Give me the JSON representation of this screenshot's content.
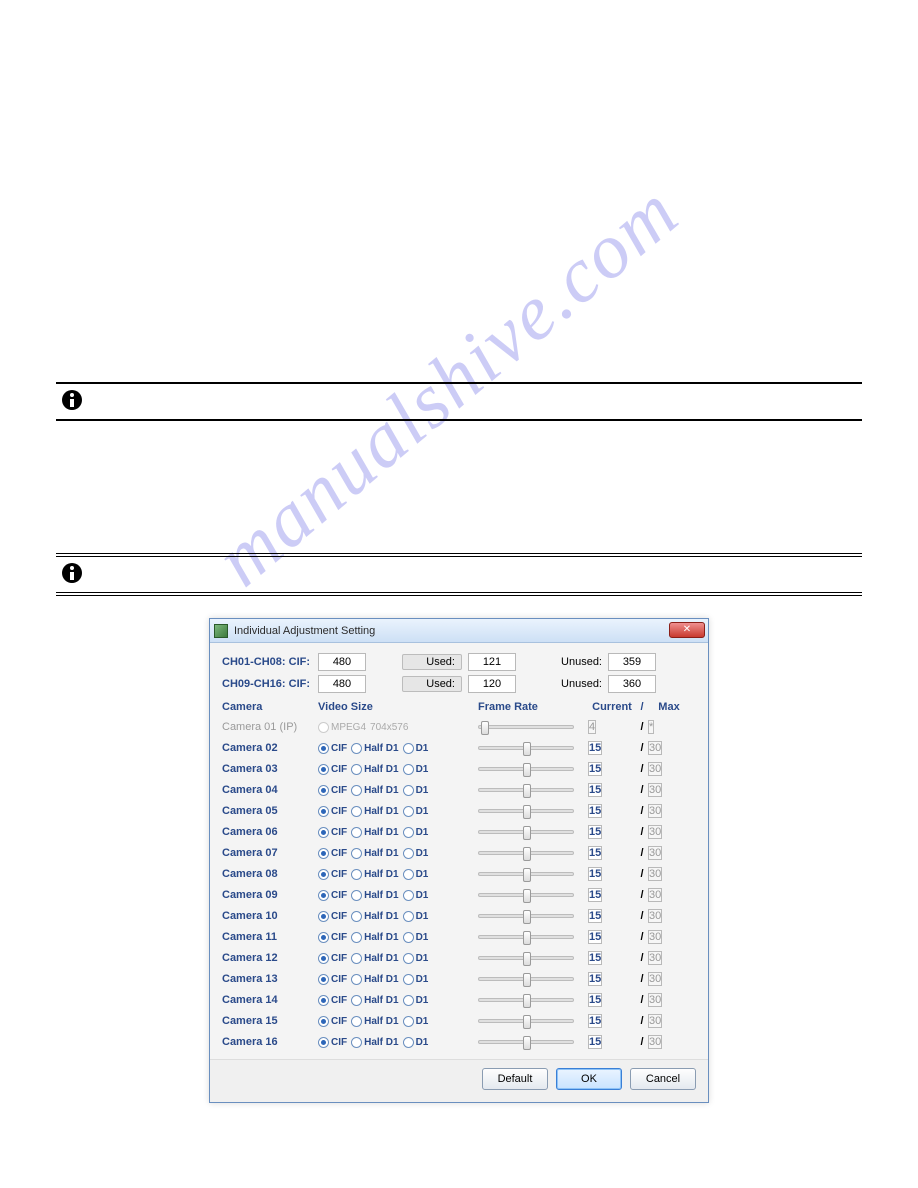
{
  "watermark": "manualshive.com",
  "dialog": {
    "title": "Individual Adjustment Setting",
    "close_label": "✕",
    "stats": [
      {
        "label": "CH01-CH08: CIF:",
        "total": "480",
        "used_label": "Used:",
        "used": "121",
        "unused_label": "Unused:",
        "unused": "359"
      },
      {
        "label": "CH09-CH16: CIF:",
        "total": "480",
        "used_label": "Used:",
        "used": "120",
        "unused_label": "Unused:",
        "unused": "360"
      }
    ],
    "headers": {
      "camera": "Camera",
      "video_size": "Video Size",
      "frame_rate": "Frame Rate",
      "current": "Current",
      "slash": "/",
      "max": "Max"
    },
    "video_size_options": {
      "cif": "CIF",
      "halfd1": "Half D1",
      "d1": "D1"
    },
    "ip_row": {
      "name": "Camera 01 (IP)",
      "codec": "MPEG4",
      "resolution": "704x576",
      "current": "4",
      "max": "*"
    },
    "rows": [
      {
        "name": "Camera 02",
        "selected": "cif",
        "current": "15",
        "max": "30"
      },
      {
        "name": "Camera 03",
        "selected": "cif",
        "current": "15",
        "max": "30"
      },
      {
        "name": "Camera 04",
        "selected": "cif",
        "current": "15",
        "max": "30"
      },
      {
        "name": "Camera 05",
        "selected": "cif",
        "current": "15",
        "max": "30"
      },
      {
        "name": "Camera 06",
        "selected": "cif",
        "current": "15",
        "max": "30"
      },
      {
        "name": "Camera 07",
        "selected": "cif",
        "current": "15",
        "max": "30"
      },
      {
        "name": "Camera 08",
        "selected": "cif",
        "current": "15",
        "max": "30"
      },
      {
        "name": "Camera 09",
        "selected": "cif",
        "current": "15",
        "max": "30"
      },
      {
        "name": "Camera 10",
        "selected": "cif",
        "current": "15",
        "max": "30"
      },
      {
        "name": "Camera 11",
        "selected": "cif",
        "current": "15",
        "max": "30"
      },
      {
        "name": "Camera 12",
        "selected": "cif",
        "current": "15",
        "max": "30"
      },
      {
        "name": "Camera 13",
        "selected": "cif",
        "current": "15",
        "max": "30"
      },
      {
        "name": "Camera 14",
        "selected": "cif",
        "current": "15",
        "max": "30"
      },
      {
        "name": "Camera 15",
        "selected": "cif",
        "current": "15",
        "max": "30"
      },
      {
        "name": "Camera 16",
        "selected": "cif",
        "current": "15",
        "max": "30"
      }
    ],
    "buttons": {
      "default": "Default",
      "ok": "OK",
      "cancel": "Cancel"
    }
  }
}
